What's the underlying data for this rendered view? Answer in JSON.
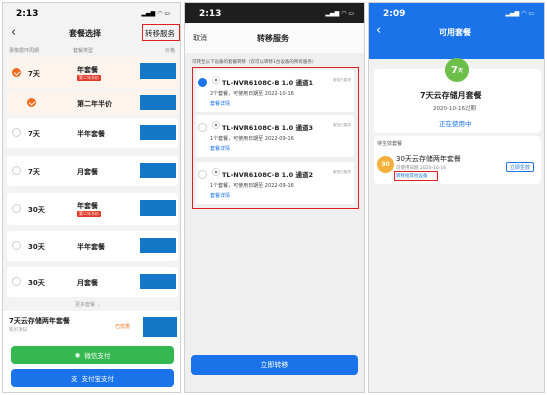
{
  "colors": {
    "accent": "#1a73e8",
    "orange": "#f26b1d",
    "green": "#35b84f",
    "highlight": "#e02020",
    "block": "#1577c8"
  },
  "panel1": {
    "time": "2:13",
    "title": "套餐选择",
    "transfer": "转移服务",
    "col_headers": [
      "录像循环周期",
      "套餐类型",
      "价格"
    ],
    "rows": [
      {
        "days": "7天",
        "pkg": "年套餐",
        "tag": "第二年半价",
        "selected": true
      },
      {
        "days": "",
        "pkg": "第二年半价",
        "tag": "",
        "selected": true
      },
      {
        "days": "7天",
        "pkg": "半年套餐",
        "tag": "",
        "selected": false
      },
      {
        "days": "7天",
        "pkg": "月套餐",
        "tag": "",
        "selected": false
      },
      {
        "days": "30天",
        "pkg": "年套餐",
        "tag": "第二年半价",
        "selected": false
      },
      {
        "days": "30天",
        "pkg": "半年套餐",
        "tag": "",
        "selected": false
      },
      {
        "days": "30天",
        "pkg": "月套餐",
        "tag": "",
        "selected": false
      }
    ],
    "more": "更多套餐",
    "summary_title": "7天云存储两年套餐",
    "summary_sub": "购买须知",
    "summary_tag": "已优惠",
    "wechat_pay": "微信支付",
    "alipay": "支付宝支付"
  },
  "panel2": {
    "time": "2:13",
    "cancel": "取消",
    "title": "转移服务",
    "desc": "可转至以下设备的套餐转移（仅可以转移1台设备的所有服务）",
    "devices": [
      {
        "name": "TL-NVR6108C-B 1.0 通道1",
        "status": "服务已暂停",
        "line": "2个套餐，可使用日期至 2022-10-16",
        "link": "套餐详情",
        "selected": true
      },
      {
        "name": "TL-NVR6108C-B 1.0 通道3",
        "status": "服务已暂停",
        "line": "1个套餐，可使用日期至 2022-09-16",
        "link": "套餐详情",
        "selected": false
      },
      {
        "name": "TL-NVR6108C-B 1.0 通道2",
        "status": "服务已暂停",
        "line": "1个套餐，可使用日期至 2022-09-16",
        "link": "套餐详情",
        "selected": false
      }
    ],
    "confirm": "立即转移"
  },
  "panel3": {
    "time": "2:09",
    "title": "可用套餐",
    "badge": "7",
    "badge_unit": "天",
    "plan_title": "7天云存储月套餐",
    "expiry": "2020-10-16过期",
    "in_use": "正在使用中",
    "pending_label": "待生效套餐",
    "pending_badge": "30",
    "pending_title": "30天云存储两年套餐",
    "pending_sub": "可使用日期 2020-10-16",
    "pending_link": "转移给其他设备",
    "activate": "立即生效"
  }
}
